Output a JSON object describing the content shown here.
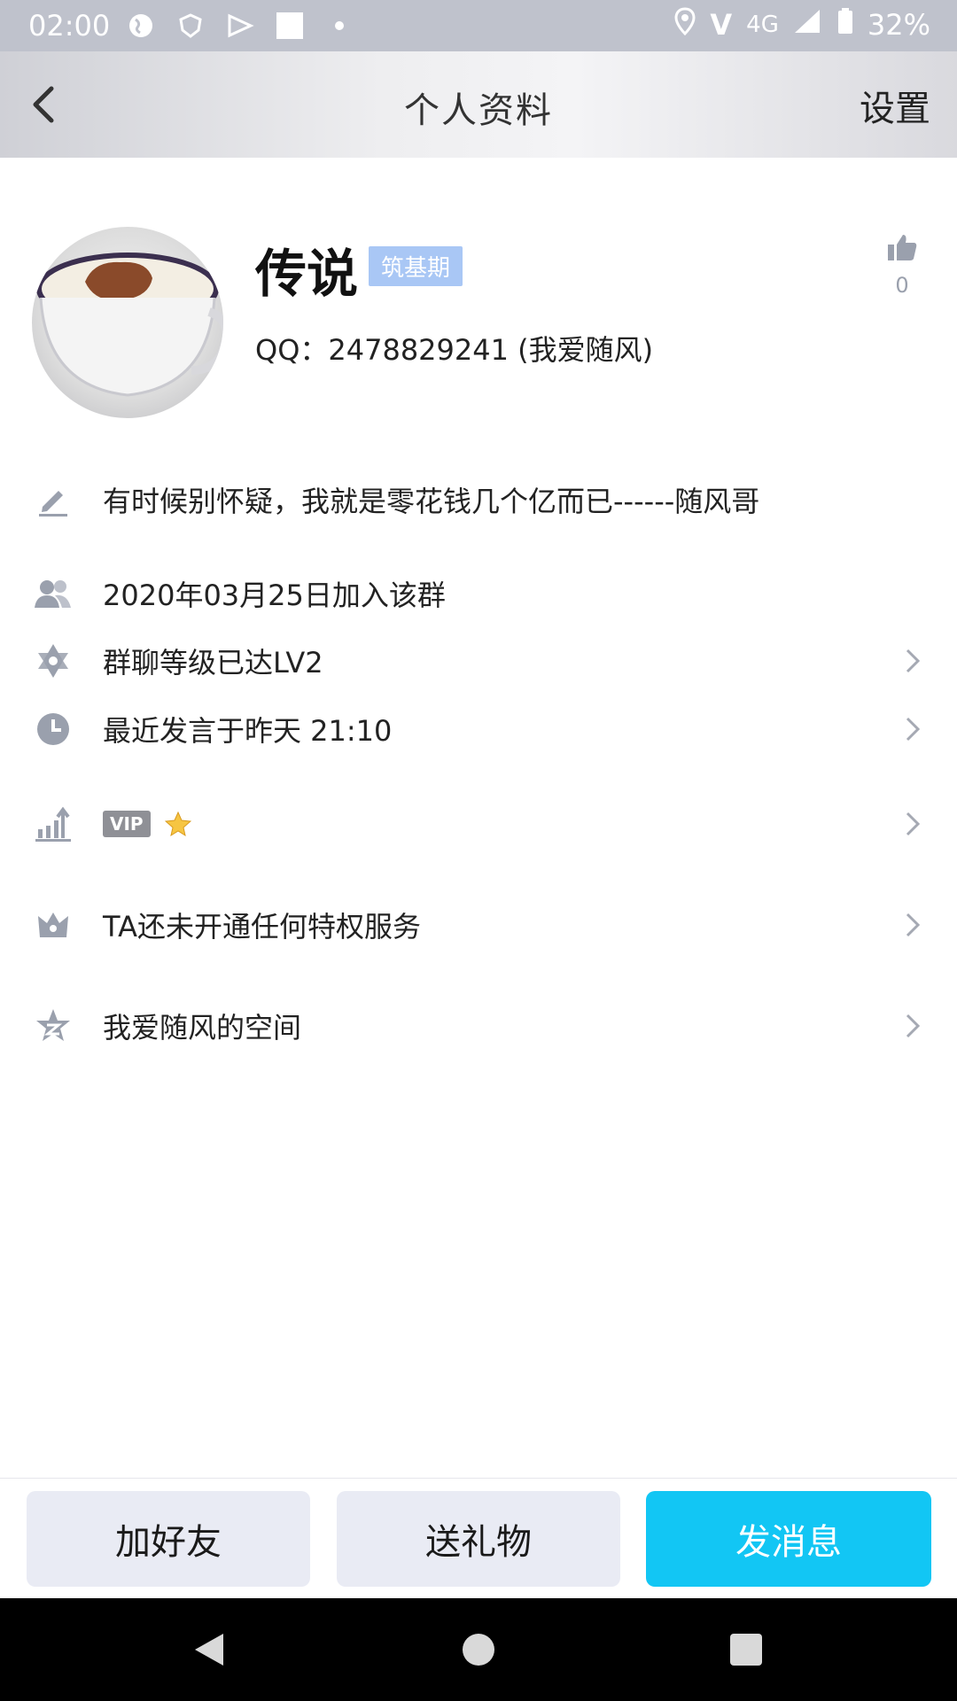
{
  "status_bar": {
    "time": "02:00",
    "network": "4G",
    "battery": "32%",
    "icons": [
      "globe-icon",
      "shield-icon",
      "play-icon",
      "square-icon",
      "dot-icon",
      "location-icon",
      "volte-icon",
      "signal-icon",
      "battery-icon"
    ]
  },
  "header": {
    "title": "个人资料",
    "settings_label": "设置"
  },
  "profile": {
    "name": "传说",
    "badge": "筑基期",
    "qq": "QQ：2478829241 (我爱随风)",
    "likes": "0"
  },
  "rows": {
    "signature": "有时候别怀疑，我就是零花钱几个亿而已------随风哥",
    "joined": "2020年03月25日加入该群",
    "level": "群聊等级已达LV2",
    "last_speak": "最近发言于昨天 21:10",
    "vip_tag": "VIP",
    "privilege": "TA还未开通任何特权服务",
    "space": "我爱随风的空间"
  },
  "actions": {
    "add_friend": "加好友",
    "send_gift": "送礼物",
    "send_message": "发消息"
  },
  "colors": {
    "accent": "#12c6f4",
    "button_gray": "#e9ebf4",
    "badge": "#a9c7f5",
    "icon_gray": "#9aa0ad"
  }
}
